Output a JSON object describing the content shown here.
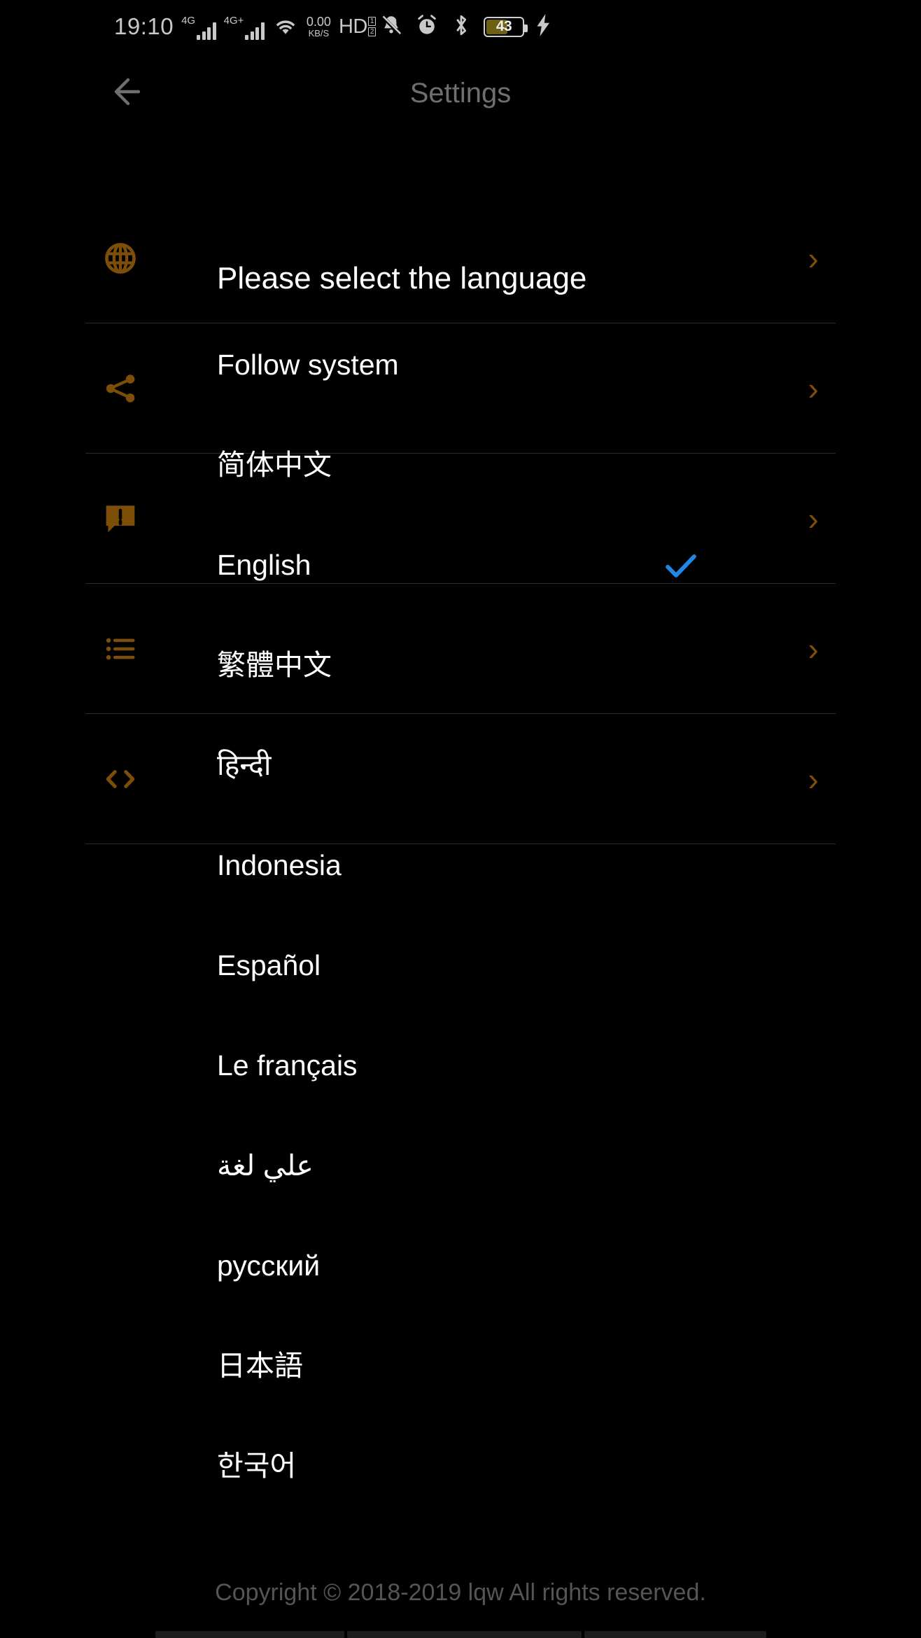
{
  "status_bar": {
    "time": "19:10",
    "network_1": {
      "tag": "4G",
      "icon": "signal-bars-icon",
      "bars": 4
    },
    "network_2": {
      "tag": "4G+",
      "icon": "signal-bars-icon",
      "bars": 4
    },
    "wifi": {
      "icon": "wifi-icon"
    },
    "data_speed": {
      "value": "0.00",
      "unit": "KB/S"
    },
    "volte": {
      "label": "HD",
      "sim_1": "1",
      "sim_2": "2"
    },
    "notifications_muted": {
      "icon": "bell-off-icon"
    },
    "alarm": {
      "icon": "alarm-clock-icon"
    },
    "bluetooth": {
      "icon": "bluetooth-icon"
    },
    "battery": {
      "icon": "battery-icon",
      "level": "43",
      "fill_color": "#6e6013",
      "charging": true
    },
    "charging": {
      "icon": "lightning-bolt-icon"
    }
  },
  "app_bar": {
    "back": {
      "icon": "arrow-left-icon"
    },
    "title": "Settings",
    "title_color": "#6f6f6f"
  },
  "background_settings_rows": [
    {
      "icon": "globe-icon",
      "chevron": "chevron-right-icon"
    },
    {
      "icon": "share-icon",
      "chevron": "chevron-right-icon"
    },
    {
      "icon": "feedback-icon",
      "chevron": "chevron-right-icon"
    },
    {
      "icon": "list-icon",
      "chevron": "chevron-right-icon"
    },
    {
      "icon": "code-icon",
      "chevron": "chevron-right-icon"
    }
  ],
  "dialog": {
    "title": "Please select the language",
    "selected_index": 2,
    "check_icon": "check-icon",
    "check_color": "#1e88e5",
    "languages": [
      {
        "label": "Follow system",
        "selected": false
      },
      {
        "label": "简体中文",
        "selected": false
      },
      {
        "label": "English",
        "selected": true
      },
      {
        "label": "繁體中文",
        "selected": false
      },
      {
        "label": "हिन्दी",
        "selected": false
      },
      {
        "label": "Indonesia",
        "selected": false
      },
      {
        "label": "Español",
        "selected": false
      },
      {
        "label": "Le français",
        "selected": false
      },
      {
        "label": "علي لغة",
        "selected": false,
        "rtl": true
      },
      {
        "label": "русский",
        "selected": false
      },
      {
        "label": "日本語",
        "selected": false
      },
      {
        "label": "한국어",
        "selected": false
      }
    ]
  },
  "footer": {
    "copyright": "Copyright © 2018-2019 lqw All rights reserved."
  },
  "theme": {
    "background": "#000000",
    "accent_brown": "#7c4e08",
    "divider": "#2b2b2b",
    "text_primary": "#ffffff",
    "text_dim": "#6f6f6f"
  }
}
